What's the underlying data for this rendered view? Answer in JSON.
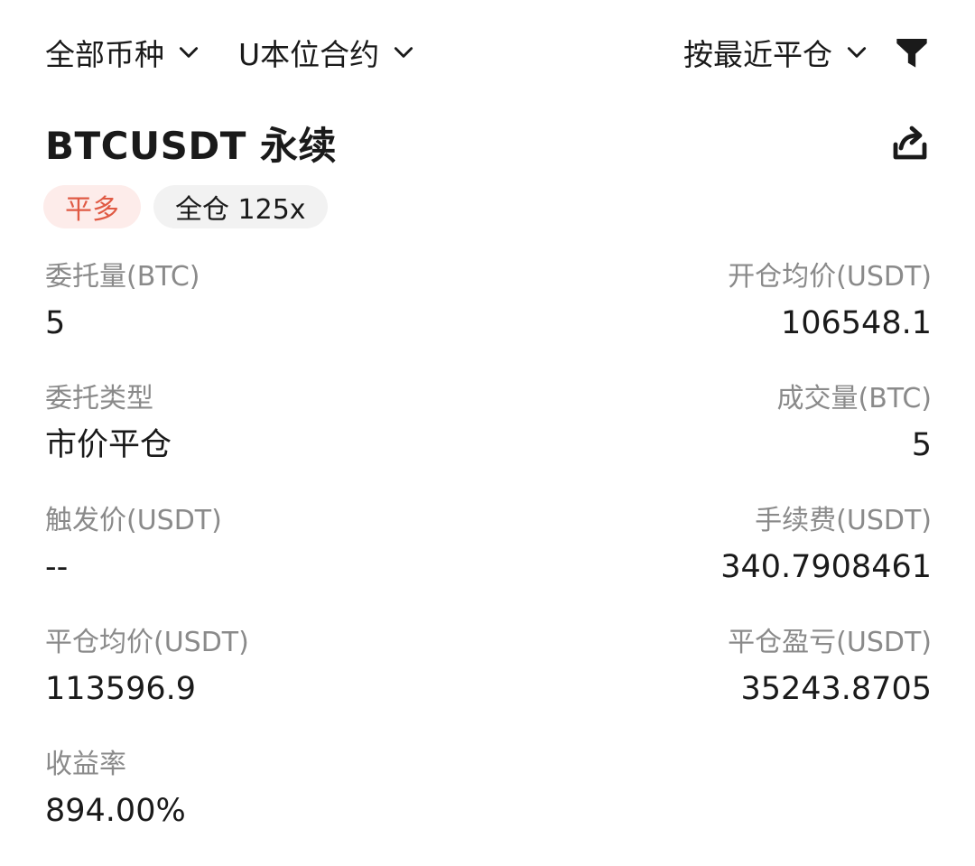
{
  "filters": {
    "coin": "全部币种",
    "contract": "U本位合约",
    "sort": "按最近平仓"
  },
  "position": {
    "title": "BTCUSDT 永续",
    "side_tag": "平多",
    "margin_tag": "全仓 125x"
  },
  "fields": {
    "order_qty": {
      "label": "委托量(BTC)",
      "value": "5"
    },
    "open_avg": {
      "label": "开仓均价(USDT)",
      "value": "106548.1"
    },
    "order_type": {
      "label": "委托类型",
      "value": "市价平仓"
    },
    "filled_qty": {
      "label": "成交量(BTC)",
      "value": "5"
    },
    "trigger_price": {
      "label": "触发价(USDT)",
      "value": "--"
    },
    "fee": {
      "label": "手续费(USDT)",
      "value": "340.7908461"
    },
    "close_avg": {
      "label": "平仓均价(USDT)",
      "value": "113596.9"
    },
    "close_pnl": {
      "label": "平仓盈亏(USDT)",
      "value": "35243.8705"
    },
    "roi": {
      "label": "收益率",
      "value": "894.00%"
    }
  },
  "colors": {
    "side_tag_text": "#e05a44",
    "side_tag_bg": "#fdecea",
    "margin_tag_bg": "#f2f2f2",
    "label_gray": "#8a8a8a",
    "text_dark": "#1a1a1a"
  },
  "icons": {
    "dropdown": "chevron-down-icon",
    "filter": "funnel-icon",
    "share": "share-icon"
  }
}
